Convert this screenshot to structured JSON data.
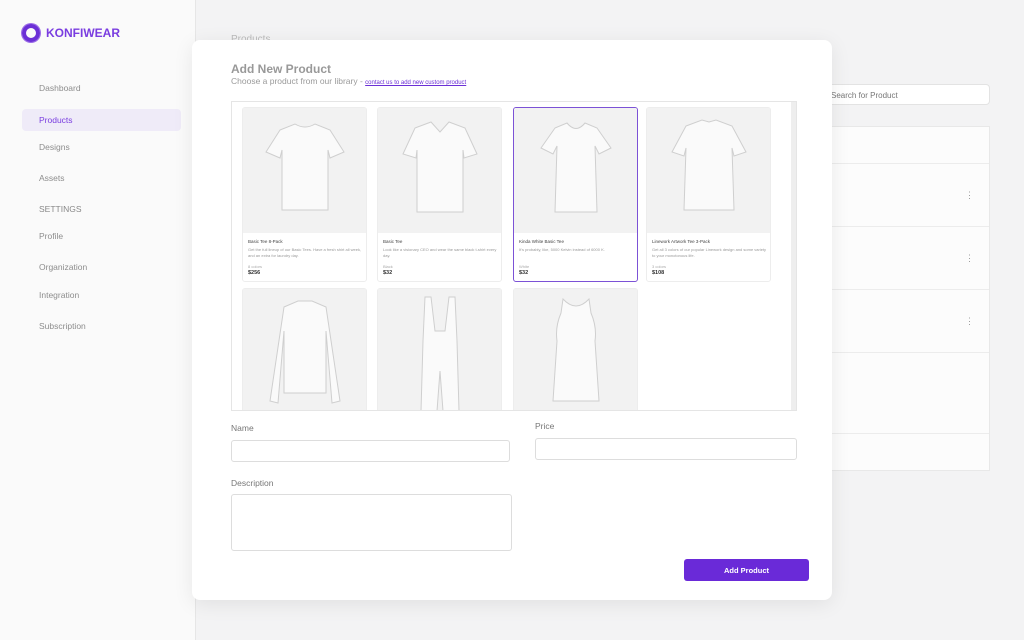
{
  "brand": "KONFIWEAR",
  "sidebar": {
    "items": [
      "Dashboard",
      "Products",
      "Designs",
      "Assets"
    ],
    "settings_heading": "SETTINGS",
    "settings_items": [
      "Profile",
      "Organization",
      "Integration",
      "Subscription"
    ]
  },
  "background": {
    "page_title": "Products",
    "search_placeholder": "Search for Product"
  },
  "modal": {
    "title": "Add New Product",
    "subtitle": "Choose a product from our library - ",
    "link": "contact us to add new custom product",
    "products": [
      {
        "name": "Basic Tee 8-Pack",
        "desc": "Get the full lineup of our Basic Tees. Have a fresh shirt all week, and an extra for laundry day.",
        "variant": "8 colors",
        "price": "$256",
        "shape": "tee"
      },
      {
        "name": "Basic Tee",
        "desc": "Look like a visionary CEO and wear the same black t-shirt every day.",
        "variant": "Black",
        "price": "$32",
        "shape": "polo"
      },
      {
        "name": "Kinda White Basic Tee",
        "desc": "It's probably, like, 5000 Kelvin instead of 6000 K.",
        "variant": "White",
        "price": "$32",
        "shape": "womentee",
        "selected": true
      },
      {
        "name": "Linework Artwork Tee 3-Pack",
        "desc": "Get all 3 colors of our popular Linework design and some variety to your monotonous life.",
        "variant": "3 colors",
        "price": "$108",
        "shape": "jersey"
      },
      {
        "shape": "longsleeve"
      },
      {
        "shape": "bib"
      },
      {
        "shape": "tank"
      }
    ],
    "name_label": "Name",
    "price_label": "Price",
    "description_label": "Description",
    "submit": "Add Product"
  }
}
